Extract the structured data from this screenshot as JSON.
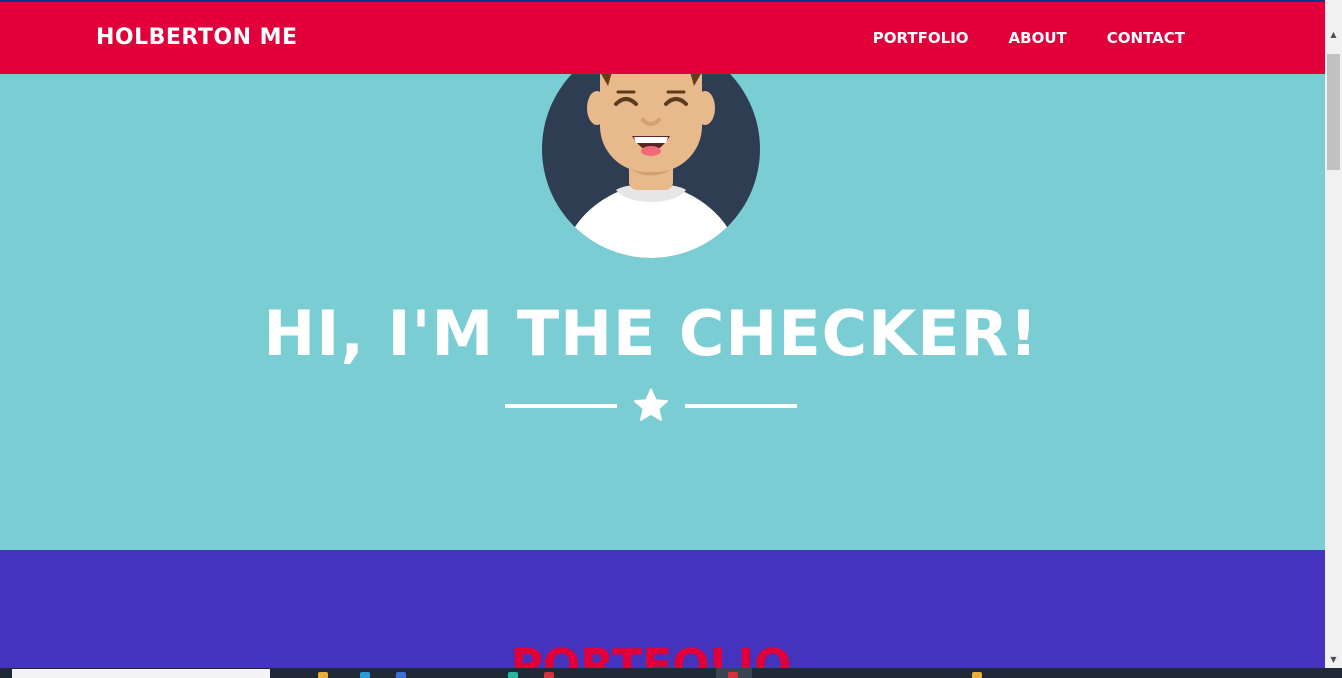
{
  "navbar": {
    "brand": "HOLBERTON ME",
    "links": [
      {
        "label": "PORTFOLIO"
      },
      {
        "label": "ABOUT"
      },
      {
        "label": "CONTACT"
      }
    ]
  },
  "hero": {
    "title": "HI, I'M THE CHECKER!",
    "divider_icon": "star-icon"
  },
  "portfolio": {
    "title": "PORTFOLIO"
  },
  "colors": {
    "nav_background": "#e2003b",
    "hero_background": "#7acdd3",
    "portfolio_background": "#4333bd",
    "portfolio_title": "#e2003b",
    "text_white": "#ffffff"
  }
}
